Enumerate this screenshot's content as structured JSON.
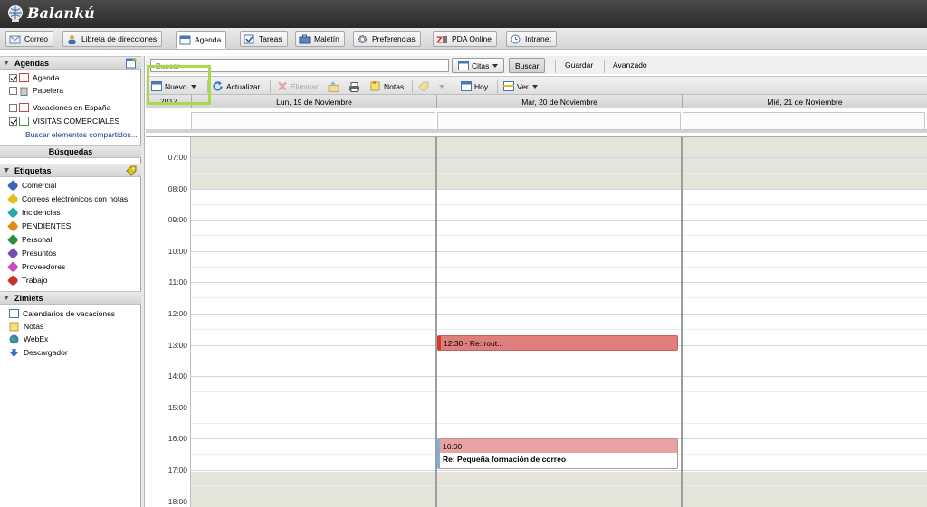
{
  "app": {
    "title": "Balankú"
  },
  "tabs": [
    {
      "label": "Correo",
      "icon": "mail-icon"
    },
    {
      "label": "Libreta de direcciones",
      "icon": "contacts-icon"
    },
    {
      "label": "Agenda",
      "icon": "calendar-icon",
      "active": true
    },
    {
      "label": "Tareas",
      "icon": "tasks-icon"
    },
    {
      "label": "Maletín",
      "icon": "briefcase-icon"
    },
    {
      "label": "Preferencias",
      "icon": "gear-icon"
    },
    {
      "label": "PDA Online",
      "icon": "sync-icon"
    },
    {
      "label": "Intranet",
      "icon": "clock-icon"
    }
  ],
  "sidebar": {
    "agendas_title": "Agendas",
    "agendas": [
      {
        "label": "Agenda",
        "checked": true
      },
      {
        "label": "Papelera",
        "checked": false
      },
      {
        "label": "Vacaciones en España",
        "checked": false
      },
      {
        "label": "VISITAS COMERCIALES",
        "checked": true
      }
    ],
    "shared_link": "Buscar elementos compartidos...",
    "searches_title": "Búsquedas",
    "tags_title": "Etiquetas",
    "tags": [
      {
        "label": "Comercial",
        "color": "#3a63b5"
      },
      {
        "label": "Correos electrónicos con notas",
        "color": "#e0c21c"
      },
      {
        "label": "Incidencias",
        "color": "#2aa6a6"
      },
      {
        "label": "PENDIENTES",
        "color": "#e08a1c"
      },
      {
        "label": "Personal",
        "color": "#2e8b3a"
      },
      {
        "label": "Presuntos",
        "color": "#7a4fb5"
      },
      {
        "label": "Proveedores",
        "color": "#c84fb5"
      },
      {
        "label": "Trabajo",
        "color": "#c8322b"
      }
    ],
    "zimlets_title": "Zimlets",
    "zimlets": [
      {
        "label": "Calendarios de vacaciones",
        "icon": "calendar-icon"
      },
      {
        "label": "Notas",
        "icon": "note-icon"
      },
      {
        "label": "WebEx",
        "icon": "globe-icon"
      },
      {
        "label": "Descargador",
        "icon": "download-arrow-icon"
      }
    ]
  },
  "search": {
    "placeholder": "Buscar",
    "type_label": "Citas",
    "search_btn": "Buscar",
    "save_btn": "Guardar",
    "advanced_btn": "Avanzado"
  },
  "toolbar": {
    "new": "Nuevo",
    "refresh": "Actualizar",
    "delete": "Eliminar",
    "notes": "Notas",
    "today": "Hoy",
    "view": "Ver"
  },
  "calendar": {
    "year": "2012",
    "days": [
      "Lun, 19 de Noviembre",
      "Mar, 20 de Noviembre",
      "Mié, 21 de Noviembre"
    ],
    "hours": [
      "07:00",
      "08:00",
      "09:00",
      "10:00",
      "11:00",
      "12:00",
      "13:00",
      "14:00",
      "15:00",
      "16:00",
      "17:00",
      "18:00"
    ],
    "appointments": [
      {
        "text": "12:30 - Re: rout...",
        "day": 1,
        "start": "12:30"
      },
      {
        "time": "16:00",
        "title": "Re: Pequeña formación de correo",
        "day": 1,
        "start": "16:00"
      }
    ]
  }
}
